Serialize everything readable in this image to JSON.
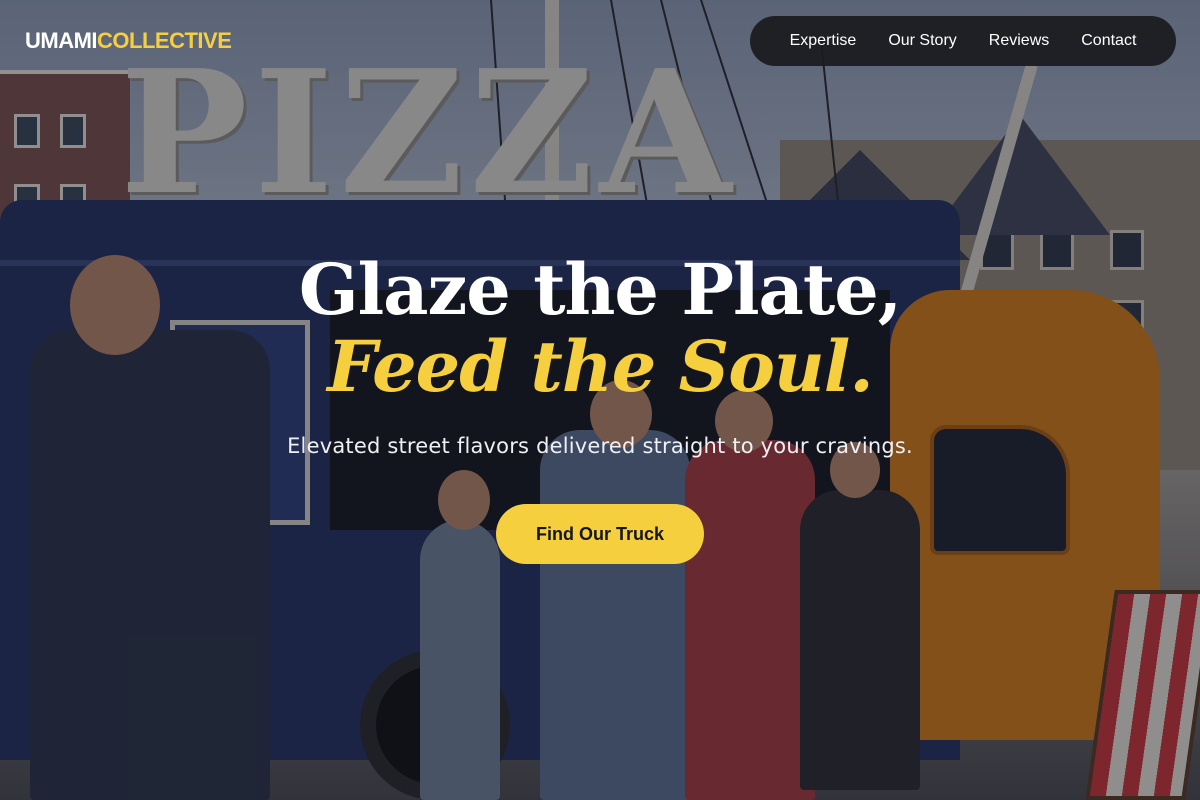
{
  "brand": {
    "name_part1": "UMAMI",
    "name_part2": "COLLECTIVE",
    "accent_color": "#f5cf3e"
  },
  "nav": {
    "items": [
      {
        "label": "Expertise"
      },
      {
        "label": "Our Story"
      },
      {
        "label": "Reviews"
      },
      {
        "label": "Contact"
      }
    ]
  },
  "hero": {
    "headline_line1": "Glaze the Plate,",
    "headline_line2": "Feed the Soul.",
    "subheadline": "Elevated street flavors delivered straight to your cravings.",
    "cta_label": "Find Our Truck",
    "background_sign_text": "PIZZA"
  }
}
